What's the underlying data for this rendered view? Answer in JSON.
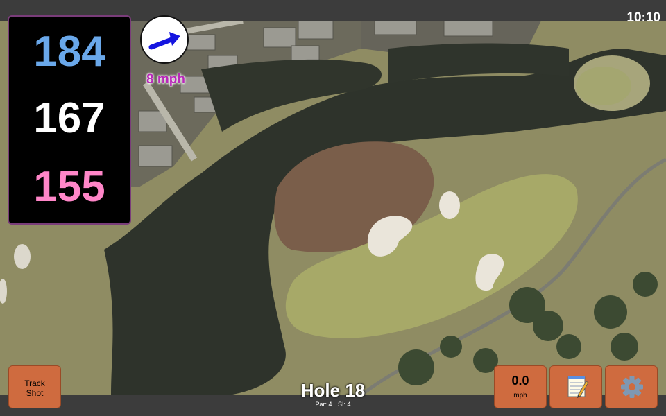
{
  "status": {
    "time": "10:10"
  },
  "distances": {
    "back": "184",
    "middle": "167",
    "front": "155"
  },
  "wind": {
    "speed_label": "8 mph",
    "arrow_icon": "wind-arrow-icon"
  },
  "hole": {
    "title": "Hole 18",
    "par": "Par: 4",
    "si": "SI: 4"
  },
  "buttons": {
    "track_line1": "Track",
    "track_line2": "Shot",
    "speed_value": "0.0",
    "speed_unit": "mph",
    "notes_icon": "notepad-icon",
    "settings_icon": "gear-icon"
  },
  "colors": {
    "back": "#6aa8ea",
    "middle": "#ffffff",
    "front": "#ff86c8",
    "button": "#cf6b3f",
    "wind_text": "#b829b8",
    "water": "#2e332b",
    "green": "#a7a968"
  }
}
